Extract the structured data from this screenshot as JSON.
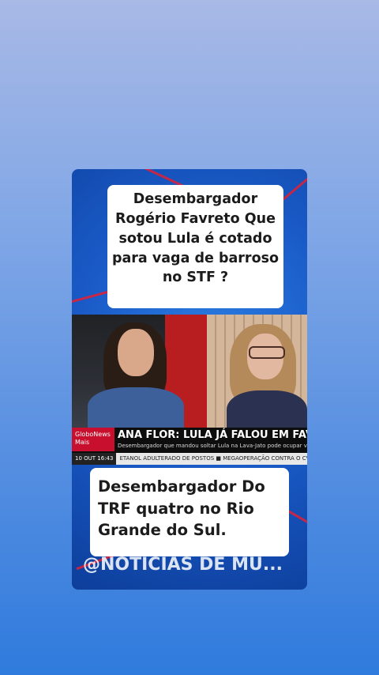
{
  "post": {
    "top_caption": "Desembargador Rogério Favreto Que sotou Lula é cotado para vaga de barroso no STF  ?",
    "bottom_caption": "Desembargador Do TRF quatro no Rio Grande do Sul.",
    "watermark": "@NOTICIAS DE MU..."
  },
  "broadcast": {
    "logo_line1": "GloboNews",
    "logo_line2": "Mais",
    "headline": "ANA FLOR: LULA JÁ FALOU EM FAVRETO",
    "subline": "Desembargador que mandou soltar Lula na Lava-Jato  pode ocupar va",
    "date": "10 OUT",
    "time": "16:43",
    "ticker": "ETANOL ADULTERADO DE POSTOS  ■  MEGAOPERAÇÃO CONTRA O CV EM"
  },
  "colors": {
    "background_top": "#a8b9e6",
    "background_bottom": "#2f7bdd",
    "accent_red": "#c8102e"
  }
}
